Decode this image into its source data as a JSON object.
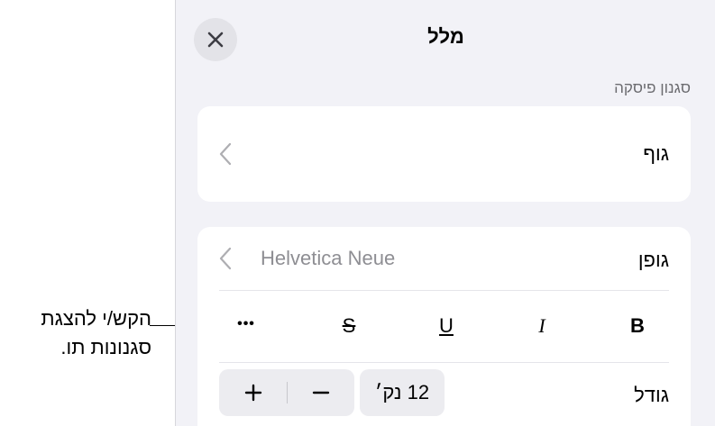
{
  "callout": {
    "line1": "הקש/י להצגת",
    "line2": "סגנונות תו."
  },
  "panel": {
    "title": "מלל",
    "close_icon": "close-icon",
    "paragraph_style_label": "סגנון פיסקה",
    "paragraph_style_value": "גוף",
    "font_label": "גופן",
    "font_value": "Helvetica Neue",
    "style_buttons": {
      "bold": "B",
      "italic": "I",
      "underline": "U",
      "strikethrough": "S",
      "more": "•••"
    },
    "size_label": "גודל",
    "size_value": "12 נק׳",
    "increase_icon": "plus-icon",
    "decrease_icon": "minus-icon"
  }
}
